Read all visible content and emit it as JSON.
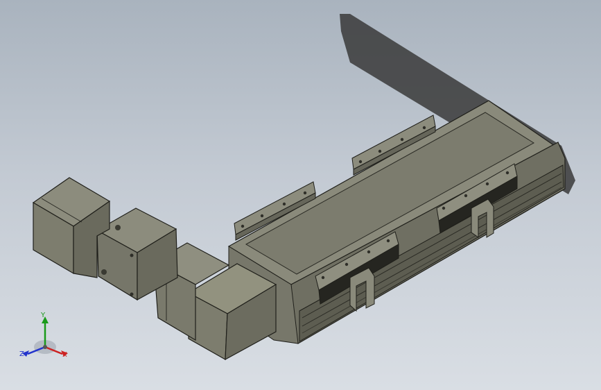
{
  "view": {
    "background_top": "#a9b3be",
    "background_bottom": "#d9dee4",
    "model_color": "#7d7d6e",
    "edge_color": "#1f1f1a"
  },
  "model": {
    "name": "linear-actuator-stage",
    "parts": [
      "motor",
      "motor-flange",
      "gearbox",
      "coupling-housing",
      "rail-body",
      "carriage-left",
      "carriage-right",
      "mounting-brackets",
      "shadow"
    ]
  },
  "triad": {
    "y_label": "Y",
    "z_label": "Z",
    "x_label": "X",
    "x_color": "#cc2222",
    "y_color": "#1a9a1a",
    "z_color": "#2233cc"
  }
}
